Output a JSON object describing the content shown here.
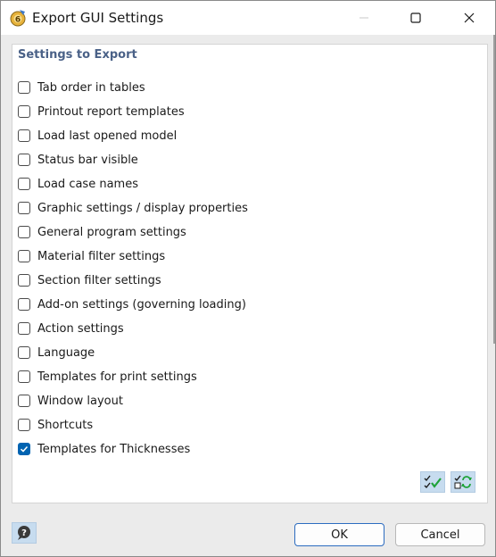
{
  "window": {
    "title": "Export GUI Settings"
  },
  "group": {
    "title": "Settings to Export"
  },
  "items": [
    {
      "label": "Tab order in tables",
      "checked": false
    },
    {
      "label": "Printout report templates",
      "checked": false
    },
    {
      "label": "Load last opened model",
      "checked": false
    },
    {
      "label": "Status bar visible",
      "checked": false
    },
    {
      "label": "Load case names",
      "checked": false
    },
    {
      "label": "Graphic settings / display properties",
      "checked": false
    },
    {
      "label": "General program settings",
      "checked": false
    },
    {
      "label": "Material filter settings",
      "checked": false
    },
    {
      "label": "Section filter settings",
      "checked": false
    },
    {
      "label": "Add-on settings (governing loading)",
      "checked": false
    },
    {
      "label": "Action settings",
      "checked": false
    },
    {
      "label": "Language",
      "checked": false
    },
    {
      "label": "Templates for print settings",
      "checked": false
    },
    {
      "label": "Window layout",
      "checked": false
    },
    {
      "label": "Shortcuts",
      "checked": false
    },
    {
      "label": "Templates for Thicknesses",
      "checked": true
    }
  ],
  "tools": {
    "select_all_icon": "select-all-icon",
    "invert_selection_icon": "invert-selection-icon"
  },
  "footer": {
    "help_icon": "help-icon",
    "ok_label": "OK",
    "cancel_label": "Cancel"
  },
  "colors": {
    "accent": "#0063b1",
    "group_title": "#4a6187",
    "tool_button_bg": "#c7dcef"
  }
}
